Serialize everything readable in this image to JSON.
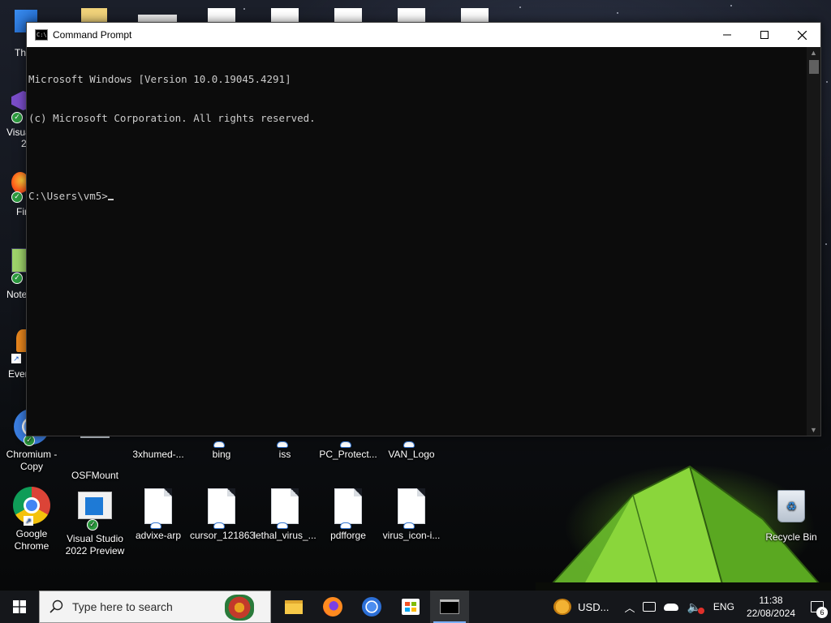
{
  "window": {
    "title": "Command Prompt",
    "lines": [
      "Microsoft Windows [Version 10.0.19045.4291]",
      "(c) Microsoft Corporation. All rights reserved.",
      "",
      "C:\\Users\\vm5>"
    ]
  },
  "desktop": {
    "left_partial": [
      "Th",
      "Visua",
      "2",
      "Fir",
      "Note",
      "Ever"
    ],
    "row1": [
      {
        "label": "Chromium - Copy",
        "icon": "chromium-icon"
      },
      {
        "label": "OSFMount",
        "icon": "osfmount-icon"
      },
      {
        "label": "3xhumed-...",
        "icon": "file-icon"
      },
      {
        "label": "bing",
        "icon": "file-icon"
      },
      {
        "label": "iss",
        "icon": "file-icon"
      },
      {
        "label": "PC_Protect...",
        "icon": "file-icon"
      },
      {
        "label": "VAN_Logo",
        "icon": "file-icon"
      }
    ],
    "row2": [
      {
        "label": "Google Chrome",
        "icon": "chrome-icon"
      },
      {
        "label": "Visual Studio 2022 Preview",
        "icon": "visual-studio-installer-icon"
      },
      {
        "label": "advixe-arp",
        "icon": "file-icon"
      },
      {
        "label": "cursor_121863",
        "icon": "file-icon"
      },
      {
        "label": "lethal_virus_...",
        "icon": "file-icon"
      },
      {
        "label": "pdfforge",
        "icon": "file-icon"
      },
      {
        "label": "virus_icon-i...",
        "icon": "file-icon"
      }
    ],
    "recycle_bin": "Recycle Bin"
  },
  "taskbar": {
    "search_placeholder": "Type here to search",
    "pinned": [
      "file-explorer-icon",
      "firefox-icon",
      "chromium-icon",
      "microsoft-store-icon",
      "command-prompt-icon"
    ],
    "weather": "USD...",
    "language": "ENG",
    "time": "11:38",
    "date": "22/08/2024",
    "notifications_count": "6"
  },
  "colors": {
    "console_bg": "#0c0c0c",
    "console_text": "#cccccc",
    "taskbar_bg": "#16181c",
    "tent_green": "#7ec83a"
  }
}
